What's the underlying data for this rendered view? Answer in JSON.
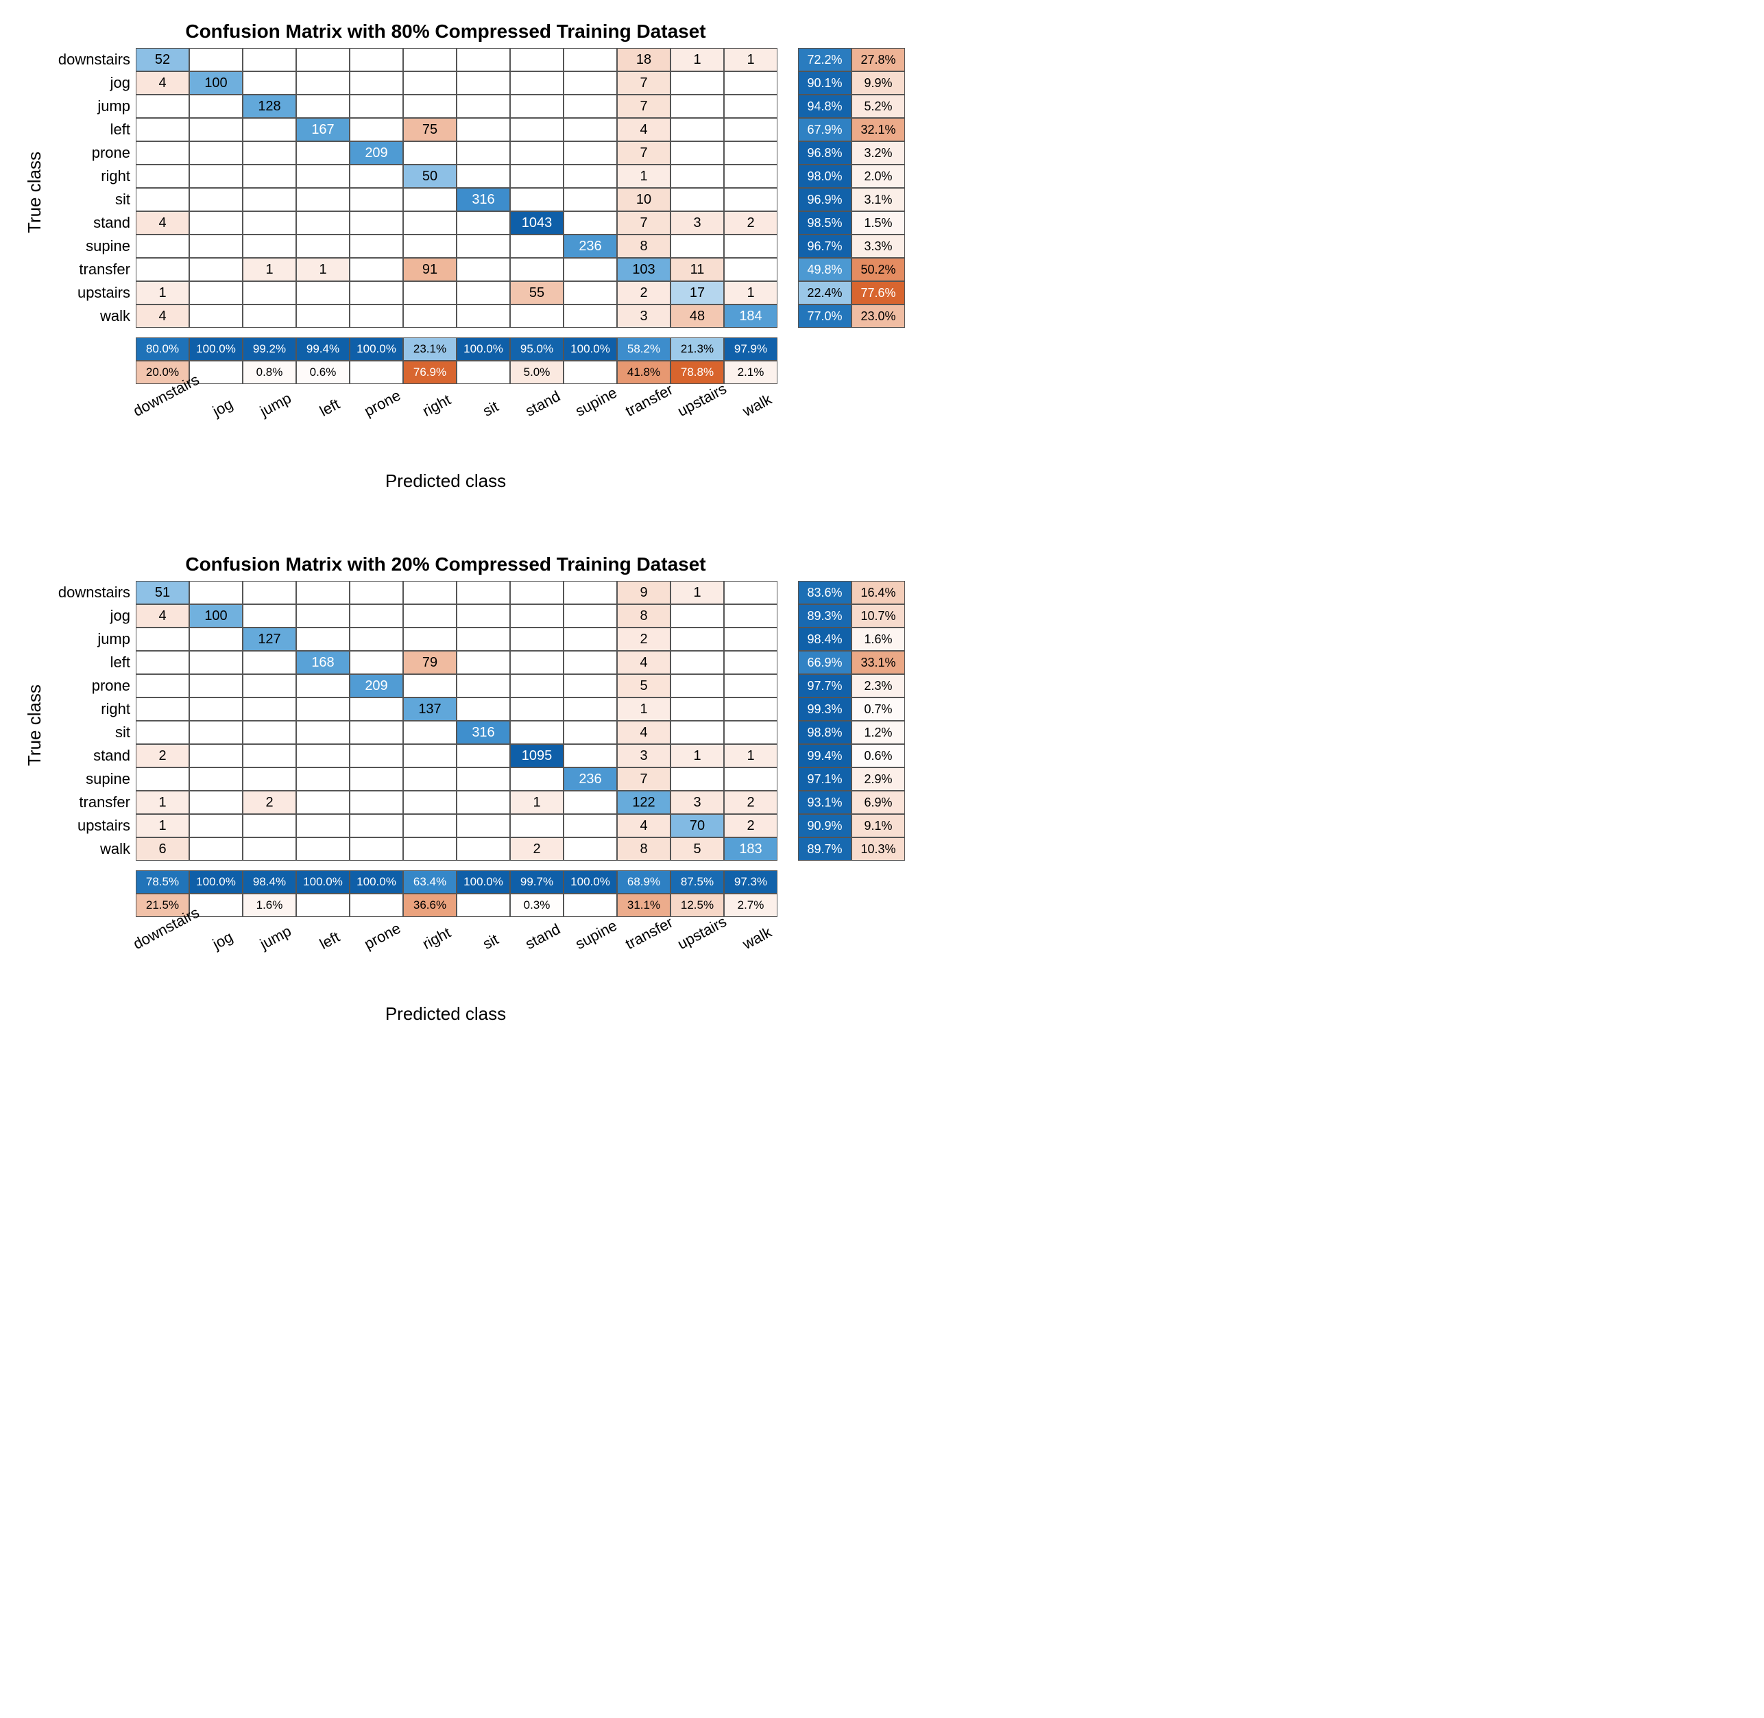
{
  "classes": [
    "downstairs",
    "jog",
    "jump",
    "left",
    "prone",
    "right",
    "sit",
    "stand",
    "supine",
    "transfer",
    "upstairs",
    "walk"
  ],
  "ylabel": "True class",
  "xlabel": "Predicted class",
  "charts": [
    {
      "title": "Confusion Matrix with 80% Compressed Training Dataset",
      "matrix": [
        [
          52,
          null,
          null,
          null,
          null,
          null,
          null,
          null,
          null,
          18,
          1,
          1
        ],
        [
          4,
          100,
          null,
          null,
          null,
          null,
          null,
          null,
          null,
          7,
          null,
          null
        ],
        [
          null,
          null,
          128,
          null,
          null,
          null,
          null,
          null,
          null,
          7,
          null,
          null
        ],
        [
          null,
          null,
          null,
          167,
          null,
          75,
          null,
          null,
          null,
          4,
          null,
          null
        ],
        [
          null,
          null,
          null,
          null,
          209,
          null,
          null,
          null,
          null,
          7,
          null,
          null
        ],
        [
          null,
          null,
          null,
          null,
          null,
          50,
          null,
          null,
          null,
          1,
          null,
          null
        ],
        [
          null,
          null,
          null,
          null,
          null,
          null,
          316,
          null,
          null,
          10,
          null,
          null
        ],
        [
          4,
          null,
          null,
          null,
          null,
          null,
          null,
          1043,
          null,
          7,
          3,
          2
        ],
        [
          null,
          null,
          null,
          null,
          null,
          null,
          null,
          null,
          236,
          8,
          null,
          null
        ],
        [
          null,
          null,
          1,
          1,
          null,
          91,
          null,
          null,
          null,
          103,
          11,
          null
        ],
        [
          1,
          null,
          null,
          null,
          null,
          null,
          null,
          55,
          null,
          2,
          17,
          1
        ],
        [
          4,
          null,
          null,
          null,
          null,
          null,
          null,
          null,
          null,
          3,
          48,
          184
        ]
      ],
      "row_summary": [
        [
          "72.2%",
          "27.8%"
        ],
        [
          "90.1%",
          "9.9%"
        ],
        [
          "94.8%",
          "5.2%"
        ],
        [
          "67.9%",
          "32.1%"
        ],
        [
          "96.8%",
          "3.2%"
        ],
        [
          "98.0%",
          "2.0%"
        ],
        [
          "96.9%",
          "3.1%"
        ],
        [
          "98.5%",
          "1.5%"
        ],
        [
          "96.7%",
          "3.3%"
        ],
        [
          "49.8%",
          "50.2%"
        ],
        [
          "22.4%",
          "77.6%"
        ],
        [
          "77.0%",
          "23.0%"
        ]
      ],
      "col_summary": [
        [
          "80.0%",
          "100.0%",
          "99.2%",
          "99.4%",
          "100.0%",
          "23.1%",
          "100.0%",
          "95.0%",
          "100.0%",
          "58.2%",
          "21.3%",
          "97.9%"
        ],
        [
          "20.0%",
          "",
          "0.8%",
          "0.6%",
          "",
          "76.9%",
          "",
          "5.0%",
          "",
          "41.8%",
          "78.8%",
          "2.1%"
        ]
      ]
    },
    {
      "title": "Confusion Matrix with 20% Compressed Training Dataset",
      "matrix": [
        [
          51,
          null,
          null,
          null,
          null,
          null,
          null,
          null,
          null,
          9,
          1,
          null
        ],
        [
          4,
          100,
          null,
          null,
          null,
          null,
          null,
          null,
          null,
          8,
          null,
          null
        ],
        [
          null,
          null,
          127,
          null,
          null,
          null,
          null,
          null,
          null,
          2,
          null,
          null
        ],
        [
          null,
          null,
          null,
          168,
          null,
          79,
          null,
          null,
          null,
          4,
          null,
          null
        ],
        [
          null,
          null,
          null,
          null,
          209,
          null,
          null,
          null,
          null,
          5,
          null,
          null
        ],
        [
          null,
          null,
          null,
          null,
          null,
          137,
          null,
          null,
          null,
          1,
          null,
          null
        ],
        [
          null,
          null,
          null,
          null,
          null,
          null,
          316,
          null,
          null,
          4,
          null,
          null
        ],
        [
          2,
          null,
          null,
          null,
          null,
          null,
          null,
          1095,
          null,
          3,
          1,
          1
        ],
        [
          null,
          null,
          null,
          null,
          null,
          null,
          null,
          null,
          236,
          7,
          null,
          null
        ],
        [
          1,
          null,
          2,
          null,
          null,
          null,
          null,
          1,
          null,
          122,
          3,
          2
        ],
        [
          1,
          null,
          null,
          null,
          null,
          null,
          null,
          null,
          null,
          4,
          70,
          2
        ],
        [
          6,
          null,
          null,
          null,
          null,
          null,
          null,
          2,
          null,
          8,
          5,
          183
        ]
      ],
      "row_summary": [
        [
          "83.6%",
          "16.4%"
        ],
        [
          "89.3%",
          "10.7%"
        ],
        [
          "98.4%",
          "1.6%"
        ],
        [
          "66.9%",
          "33.1%"
        ],
        [
          "97.7%",
          "2.3%"
        ],
        [
          "99.3%",
          "0.7%"
        ],
        [
          "98.8%",
          "1.2%"
        ],
        [
          "99.4%",
          "0.6%"
        ],
        [
          "97.1%",
          "2.9%"
        ],
        [
          "93.1%",
          "6.9%"
        ],
        [
          "90.9%",
          "9.1%"
        ],
        [
          "89.7%",
          "10.3%"
        ]
      ],
      "col_summary": [
        [
          "78.5%",
          "100.0%",
          "98.4%",
          "100.0%",
          "100.0%",
          "63.4%",
          "100.0%",
          "99.7%",
          "100.0%",
          "68.9%",
          "87.5%",
          "97.3%"
        ],
        [
          "21.5%",
          "",
          "1.6%",
          "",
          "",
          "36.6%",
          "",
          "0.3%",
          "",
          "31.1%",
          "12.5%",
          "2.7%"
        ]
      ]
    }
  ],
  "chart_data": [
    {
      "type": "heatmap",
      "title": "Confusion Matrix with 80% Compressed Training Dataset",
      "xlabel": "Predicted class",
      "ylabel": "True class",
      "categories": [
        "downstairs",
        "jog",
        "jump",
        "left",
        "prone",
        "right",
        "sit",
        "stand",
        "supine",
        "transfer",
        "upstairs",
        "walk"
      ],
      "values": [
        [
          52,
          0,
          0,
          0,
          0,
          0,
          0,
          0,
          0,
          18,
          1,
          1
        ],
        [
          4,
          100,
          0,
          0,
          0,
          0,
          0,
          0,
          0,
          7,
          0,
          0
        ],
        [
          0,
          0,
          128,
          0,
          0,
          0,
          0,
          0,
          0,
          7,
          0,
          0
        ],
        [
          0,
          0,
          0,
          167,
          0,
          75,
          0,
          0,
          0,
          4,
          0,
          0
        ],
        [
          0,
          0,
          0,
          0,
          209,
          0,
          0,
          0,
          0,
          7,
          0,
          0
        ],
        [
          0,
          0,
          0,
          0,
          0,
          50,
          0,
          0,
          0,
          1,
          0,
          0
        ],
        [
          0,
          0,
          0,
          0,
          0,
          0,
          316,
          0,
          0,
          10,
          0,
          0
        ],
        [
          4,
          0,
          0,
          0,
          0,
          0,
          0,
          1043,
          0,
          7,
          3,
          2
        ],
        [
          0,
          0,
          0,
          0,
          0,
          0,
          0,
          0,
          236,
          8,
          0,
          0
        ],
        [
          0,
          0,
          1,
          1,
          0,
          91,
          0,
          0,
          0,
          103,
          11,
          0
        ],
        [
          1,
          0,
          0,
          0,
          0,
          0,
          0,
          55,
          0,
          2,
          17,
          1
        ],
        [
          4,
          0,
          0,
          0,
          0,
          0,
          0,
          0,
          0,
          3,
          48,
          184
        ]
      ],
      "row_recall_pct": [
        72.2,
        90.1,
        94.8,
        67.9,
        96.8,
        98.0,
        96.9,
        98.5,
        96.7,
        49.8,
        22.4,
        77.0
      ],
      "col_precision_pct": [
        80.0,
        100.0,
        99.2,
        99.4,
        100.0,
        23.1,
        100.0,
        95.0,
        100.0,
        58.2,
        21.3,
        97.9
      ]
    },
    {
      "type": "heatmap",
      "title": "Confusion Matrix with 20% Compressed Training Dataset",
      "xlabel": "Predicted class",
      "ylabel": "True class",
      "categories": [
        "downstairs",
        "jog",
        "jump",
        "left",
        "prone",
        "right",
        "sit",
        "stand",
        "supine",
        "transfer",
        "upstairs",
        "walk"
      ],
      "values": [
        [
          51,
          0,
          0,
          0,
          0,
          0,
          0,
          0,
          0,
          9,
          1,
          0
        ],
        [
          4,
          100,
          0,
          0,
          0,
          0,
          0,
          0,
          0,
          8,
          0,
          0
        ],
        [
          0,
          0,
          127,
          0,
          0,
          0,
          0,
          0,
          0,
          2,
          0,
          0
        ],
        [
          0,
          0,
          0,
          168,
          0,
          79,
          0,
          0,
          0,
          4,
          0,
          0
        ],
        [
          0,
          0,
          0,
          0,
          209,
          0,
          0,
          0,
          0,
          5,
          0,
          0
        ],
        [
          0,
          0,
          0,
          0,
          0,
          137,
          0,
          0,
          0,
          1,
          0,
          0
        ],
        [
          0,
          0,
          0,
          0,
          0,
          0,
          316,
          0,
          0,
          4,
          0,
          0
        ],
        [
          2,
          0,
          0,
          0,
          0,
          0,
          0,
          1095,
          0,
          3,
          1,
          1
        ],
        [
          0,
          0,
          0,
          0,
          0,
          0,
          0,
          0,
          236,
          7,
          0,
          0
        ],
        [
          1,
          0,
          2,
          0,
          0,
          0,
          0,
          1,
          0,
          122,
          3,
          2
        ],
        [
          1,
          0,
          0,
          0,
          0,
          0,
          0,
          0,
          0,
          4,
          70,
          2
        ],
        [
          6,
          0,
          0,
          0,
          0,
          0,
          0,
          2,
          0,
          8,
          5,
          183
        ]
      ],
      "row_recall_pct": [
        83.6,
        89.3,
        98.4,
        66.9,
        97.7,
        99.3,
        98.8,
        99.4,
        97.1,
        93.1,
        90.9,
        89.7
      ],
      "col_precision_pct": [
        78.5,
        100.0,
        98.4,
        100.0,
        100.0,
        63.4,
        100.0,
        99.7,
        100.0,
        68.9,
        87.5,
        97.3
      ]
    }
  ]
}
